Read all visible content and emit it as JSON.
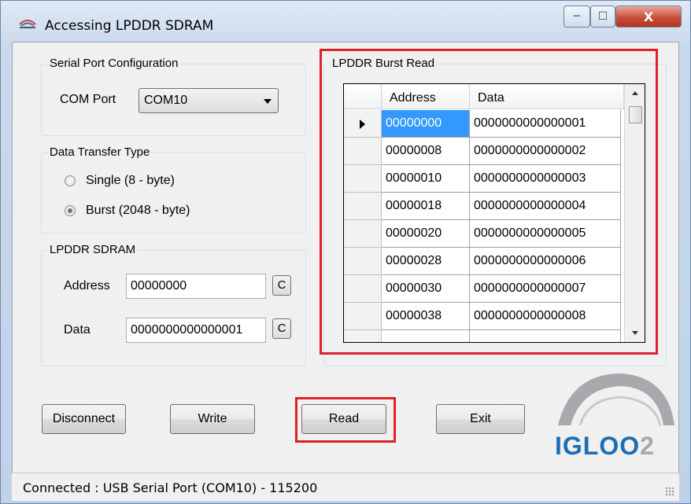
{
  "window": {
    "title": "Accessing LPDDR SDRAM",
    "min_icon": "minimize-icon",
    "max_icon": "maximize-icon",
    "close_icon": "close-icon",
    "close_glyph": "X"
  },
  "serial": {
    "group_label": "Serial Port Configuration",
    "com_label": "COM Port",
    "com_value": "COM10"
  },
  "transfer": {
    "group_label": "Data Transfer Type",
    "single_label": "Single (8 - byte)",
    "burst_label": "Burst (2048 - byte)",
    "selected": "burst"
  },
  "sdram": {
    "group_label": "LPDDR SDRAM",
    "address_label": "Address",
    "address_value": "00000000",
    "data_label": "Data",
    "data_value": "0000000000000001",
    "clear_label": "C"
  },
  "burst": {
    "group_label": "LPDDR Burst Read",
    "columns": [
      "Address",
      "Data"
    ],
    "rows": [
      {
        "address": "00000000",
        "data": "0000000000000001"
      },
      {
        "address": "00000008",
        "data": "0000000000000002"
      },
      {
        "address": "00000010",
        "data": "0000000000000003"
      },
      {
        "address": "00000018",
        "data": "0000000000000004"
      },
      {
        "address": "00000020",
        "data": "0000000000000005"
      },
      {
        "address": "00000028",
        "data": "0000000000000006"
      },
      {
        "address": "00000030",
        "data": "0000000000000007"
      },
      {
        "address": "00000038",
        "data": "0000000000000008"
      }
    ]
  },
  "buttons": {
    "disconnect": "Disconnect",
    "write": "Write",
    "read": "Read",
    "exit": "Exit"
  },
  "logo": {
    "text_main": "IGLOO",
    "text_suffix": "2"
  },
  "status": {
    "text": "Connected : USB Serial Port (COM10) - 115200"
  },
  "colors": {
    "highlight_red": "#e0202a",
    "selection_blue": "#3399ff",
    "logo_blue": "#1c6fb4",
    "logo_gray": "#a7a9ac"
  }
}
